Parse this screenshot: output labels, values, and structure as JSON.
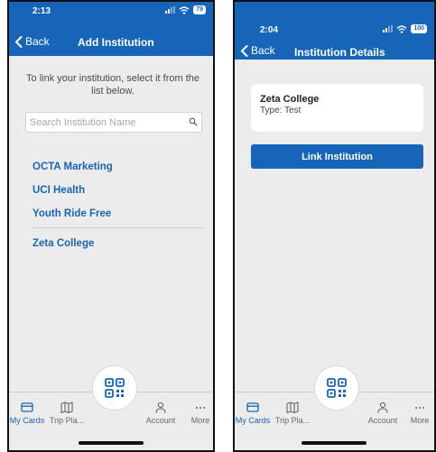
{
  "colors": {
    "brand": "#1665b8",
    "link": "#1a64b5",
    "background": "#ececec"
  },
  "screen1": {
    "status": {
      "time": "2:13",
      "battery": "79"
    },
    "header": {
      "back_label": "Back",
      "title": "Add Institution"
    },
    "instruction": "To link your institution, select it from the list below.",
    "search": {
      "placeholder": "Search Institution Name",
      "value": "",
      "icon": "search-icon"
    },
    "institutions": [
      {
        "label": "OCTA Marketing"
      },
      {
        "label": "UCI Health"
      },
      {
        "label": "Youth Ride Free"
      },
      {
        "label": "Zeta College"
      }
    ]
  },
  "screen2": {
    "status": {
      "time": "2:04",
      "battery": "100"
    },
    "header": {
      "back_label": "Back",
      "title": "Institution Details"
    },
    "detail": {
      "name": "Zeta College",
      "type": "Type: Test"
    },
    "link_button": "Link Institution"
  },
  "tabs": {
    "my_cards": {
      "label": "My Cards",
      "icon": "card-icon",
      "active": true
    },
    "trip_planner": {
      "label": "Trip Pla...",
      "icon": "map-icon"
    },
    "scan": {
      "icon": "qr-code-icon"
    },
    "account": {
      "label": "Account",
      "icon": "person-icon"
    },
    "more": {
      "label": "More",
      "icon": "ellipsis-icon"
    }
  }
}
